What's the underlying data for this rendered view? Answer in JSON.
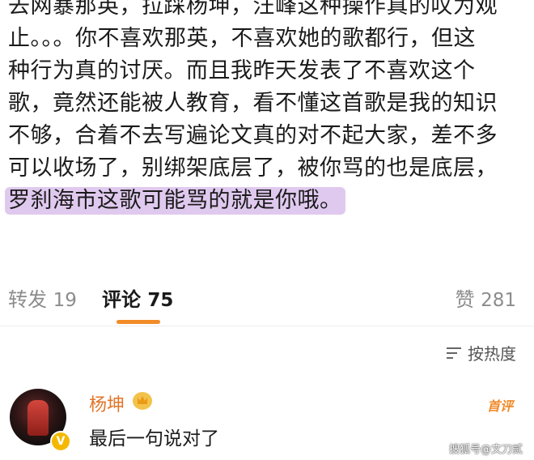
{
  "post": {
    "lines": [
      "去网暴那英，拉踩杨坤，汪峰这种操作真的叹为观",
      "止。。。你不喜欢那英，不喜欢她的歌都行，但这",
      "种行为真的讨厌。而且我昨天发表了不喜欢这个",
      "歌，竟然还能被人教育，看不懂这首歌是我的知识",
      "不够，合着不去写遍论文真的对不起大家，差不多",
      "可以收场了，别绑架底层了，被你骂的也是底层，"
    ],
    "highlight": "罗刹海市这歌可能骂的就是你哦。"
  },
  "tabs": {
    "repost_label": "转发",
    "repost_count": "19",
    "comment_label": "评论",
    "comment_count": "75",
    "like_label": "赞",
    "like_count": "281"
  },
  "sort": {
    "label": "按热度",
    "icon": "sort-icon"
  },
  "comment": {
    "username": "杨坤",
    "badge": "首评",
    "text": "最后一句说对了",
    "verified_mark": "V"
  },
  "watermark": "搜狐号@文刀贰",
  "colors": {
    "accent": "#f28c28",
    "highlight": "#e0c9ee",
    "username": "#e0762a"
  }
}
